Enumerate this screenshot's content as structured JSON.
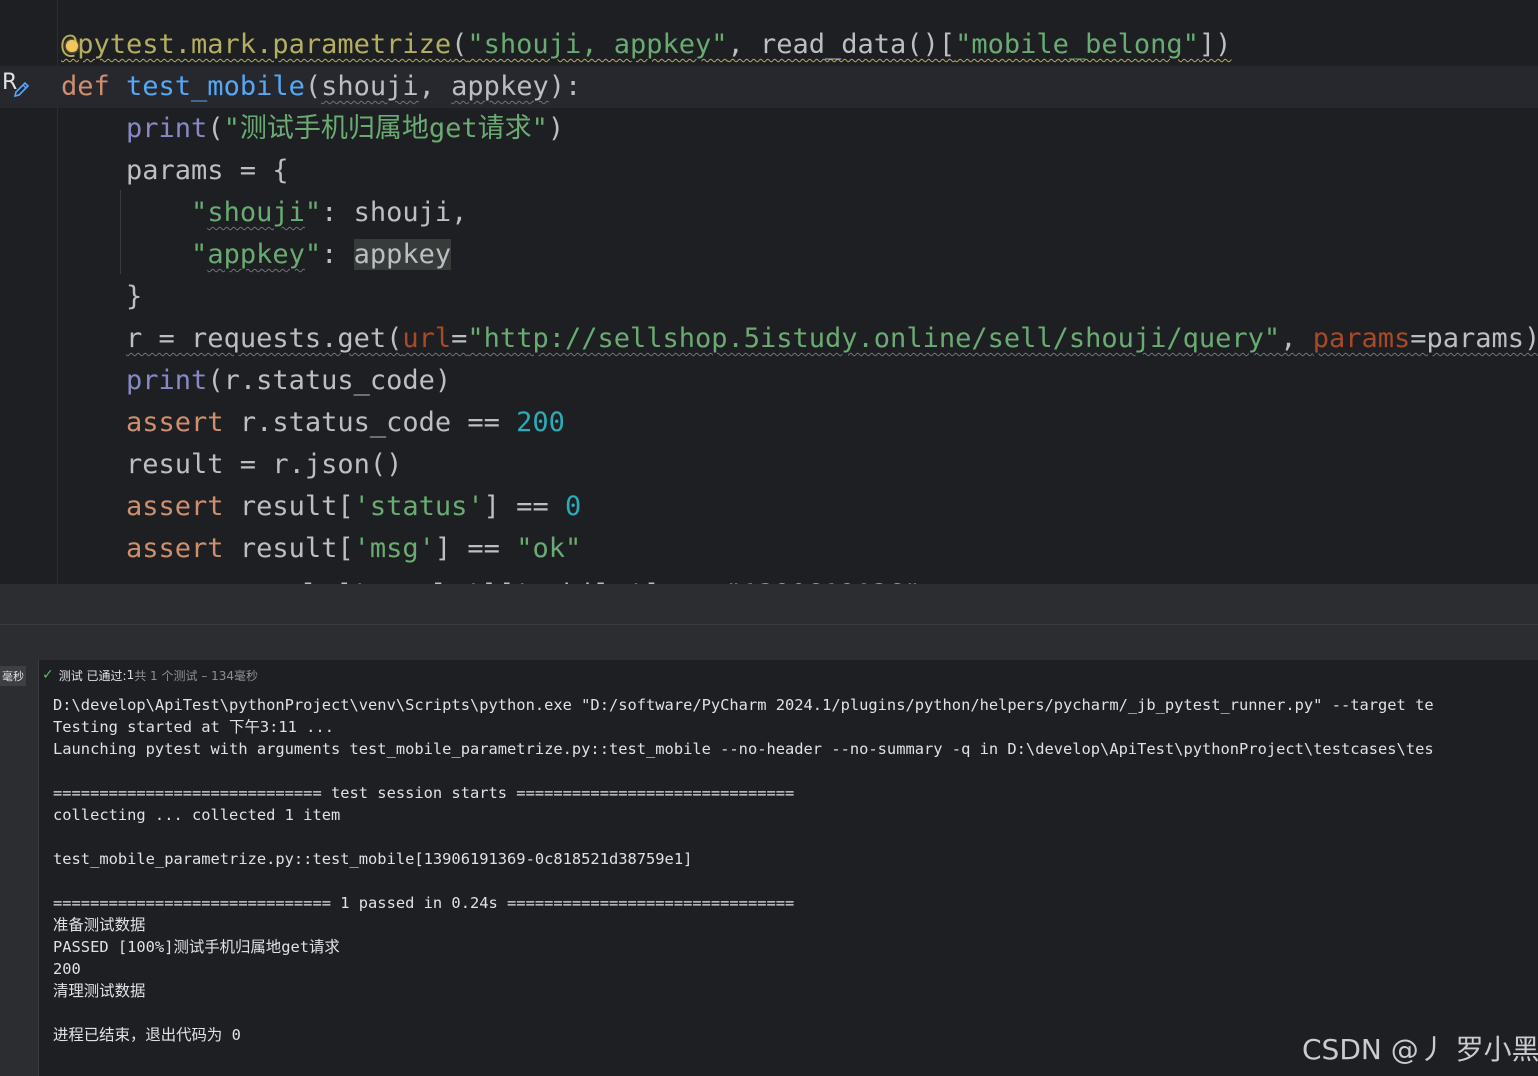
{
  "editor": {
    "lines": [
      {
        "segments": [
          {
            "cls": "k-dec squig-y",
            "text": "@pytest.mark.parametrize"
          },
          {
            "cls": "k-txt squig-y",
            "text": "("
          },
          {
            "cls": "k-str squig-y",
            "text": "\"shouji, appkey\""
          },
          {
            "cls": "k-txt squig-y",
            "text": ", read_data()["
          },
          {
            "cls": "k-str squig-y",
            "text": "\"mobile_belong\""
          },
          {
            "cls": "k-txt squig-y",
            "text": "])"
          }
        ]
      },
      {
        "segments": [
          {
            "cls": "k-kw",
            "text": "def "
          },
          {
            "cls": "k-fn",
            "text": "test_mobile"
          },
          {
            "cls": "k-txt",
            "text": "("
          },
          {
            "cls": "k-txt squig",
            "text": "shouji"
          },
          {
            "cls": "k-txt",
            "text": ", "
          },
          {
            "cls": "k-txt squig",
            "text": "appkey"
          },
          {
            "cls": "k-txt",
            "text": "):"
          }
        ]
      },
      {
        "segments": [
          {
            "cls": "k-txt",
            "text": "    "
          },
          {
            "cls": "k-bi",
            "text": "print"
          },
          {
            "cls": "k-txt",
            "text": "("
          },
          {
            "cls": "k-str",
            "text": "\"测试手机归属地get请求\""
          },
          {
            "cls": "k-txt",
            "text": ")"
          }
        ]
      },
      {
        "segments": [
          {
            "cls": "k-txt",
            "text": "    params = {"
          }
        ]
      },
      {
        "segments": [
          {
            "cls": "k-txt",
            "text": "        "
          },
          {
            "cls": "k-str",
            "text": "\""
          },
          {
            "cls": "k-str squig",
            "text": "shouji"
          },
          {
            "cls": "k-str",
            "text": "\""
          },
          {
            "cls": "k-txt",
            "text": ": shouji,"
          }
        ]
      },
      {
        "segments": [
          {
            "cls": "k-txt",
            "text": "        "
          },
          {
            "cls": "k-str",
            "text": "\""
          },
          {
            "cls": "k-str squig",
            "text": "appkey"
          },
          {
            "cls": "k-str",
            "text": "\""
          },
          {
            "cls": "k-txt",
            "text": ": "
          },
          {
            "cls": "k-txt hl-var",
            "text": "appkey"
          }
        ]
      },
      {
        "segments": [
          {
            "cls": "k-txt",
            "text": "    }"
          }
        ]
      },
      {
        "segments": [
          {
            "cls": "k-txt",
            "text": "    "
          },
          {
            "cls": "k-txt squig",
            "text": "r = requests.get("
          },
          {
            "cls": "k-param squig",
            "text": "url"
          },
          {
            "cls": "k-txt squig",
            "text": "="
          },
          {
            "cls": "k-str squig",
            "text": "\"http://sellshop.5istudy.online/sell/shouji/query\""
          },
          {
            "cls": "k-txt squig",
            "text": ", "
          },
          {
            "cls": "k-param squig",
            "text": "params"
          },
          {
            "cls": "k-txt squig",
            "text": "=params)"
          }
        ]
      },
      {
        "segments": [
          {
            "cls": "k-txt",
            "text": "    "
          },
          {
            "cls": "k-bi",
            "text": "print"
          },
          {
            "cls": "k-txt",
            "text": "(r.status_code)"
          }
        ]
      },
      {
        "segments": [
          {
            "cls": "k-txt",
            "text": "    "
          },
          {
            "cls": "k-kw",
            "text": "assert "
          },
          {
            "cls": "k-txt",
            "text": "r.status_code == "
          },
          {
            "cls": "k-num",
            "text": "200"
          }
        ]
      },
      {
        "segments": [
          {
            "cls": "k-txt",
            "text": "    result = r.json()"
          }
        ]
      },
      {
        "segments": [
          {
            "cls": "k-txt",
            "text": "    "
          },
          {
            "cls": "k-kw",
            "text": "assert "
          },
          {
            "cls": "k-txt",
            "text": "result["
          },
          {
            "cls": "k-str",
            "text": "'status'"
          },
          {
            "cls": "k-txt",
            "text": "] == "
          },
          {
            "cls": "k-num",
            "text": "0"
          }
        ]
      },
      {
        "segments": [
          {
            "cls": "k-txt",
            "text": "    "
          },
          {
            "cls": "k-kw",
            "text": "assert "
          },
          {
            "cls": "k-txt",
            "text": "result["
          },
          {
            "cls": "k-str",
            "text": "'msg'"
          },
          {
            "cls": "k-txt",
            "text": "] == "
          },
          {
            "cls": "k-str",
            "text": "\"ok\""
          }
        ]
      }
    ],
    "gutter_run_label": "R",
    "gutter_icon": "edit-pencil-icon",
    "intention_icon": "lightbulb-icon"
  },
  "run_panel": {
    "time_badge": "毫秒",
    "status_icon": "check-icon",
    "status_prefix": "测试 已通过: ",
    "status_count": "1",
    "status_suffix": "共 1 个测试 – 134毫秒",
    "console_lines": [
      "D:\\develop\\ApiTest\\pythonProject\\venv\\Scripts\\python.exe \"D:/software/PyCharm 2024.1/plugins/python/helpers/pycharm/_jb_pytest_runner.py\" --target te",
      "Testing started at 下午3:11 ...",
      "Launching pytest with arguments test_mobile_parametrize.py::test_mobile --no-header --no-summary -q in D:\\develop\\ApiTest\\pythonProject\\testcases\\tes",
      "",
      "============================= test session starts ==============================",
      "collecting ... collected 1 item",
      "",
      "test_mobile_parametrize.py::test_mobile[13906191369-0c818521d38759e1]",
      "",
      "============================== 1 passed in 0.24s ===============================",
      "准备测试数据",
      "PASSED [100%]测试手机归属地get请求",
      "200",
      "清理测试数据",
      "",
      "进程已结束，退出代码为 0"
    ]
  },
  "watermark": "CSDN @丿 罗小黑"
}
